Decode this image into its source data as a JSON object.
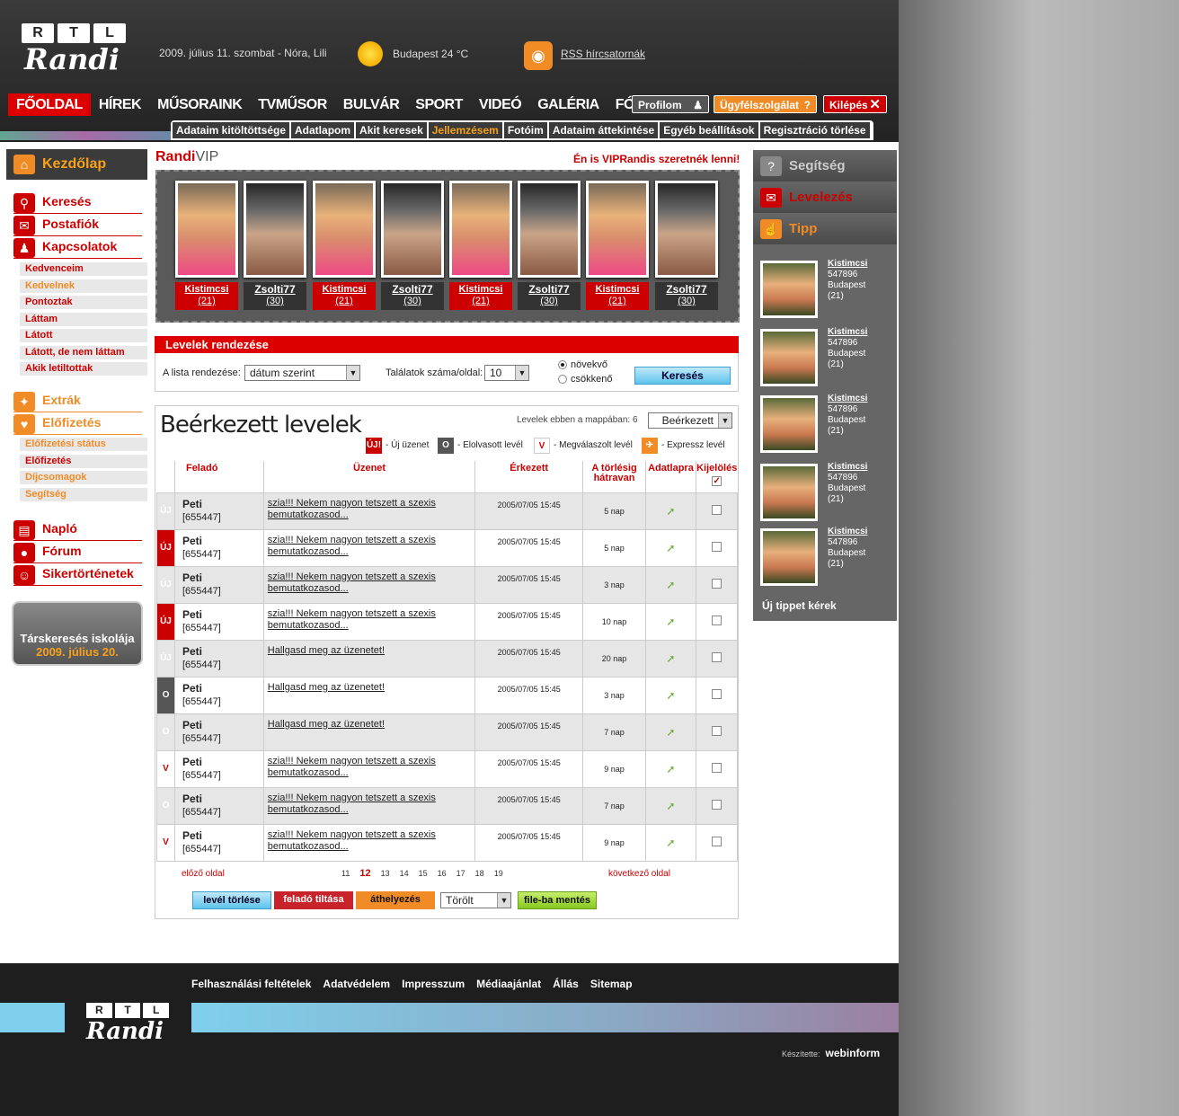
{
  "header": {
    "logo_rtl": [
      "R",
      "T",
      "L"
    ],
    "logo_randi": "Randi",
    "date_line": "2009. július 11. szombat - Nóra, Lili",
    "weather": "Budapest 24 °C",
    "rss": "RSS hírcsatornák"
  },
  "mainnav": [
    "FŐOLDAL",
    "HÍREK",
    "MŰSORAINK",
    "TVMŰSOR",
    "BULVÁR",
    "SPORT",
    "VIDEÓ",
    "GALÉRIA",
    "FÓRUM"
  ],
  "header_buttons": {
    "profile": "Profilom",
    "service": "Ügyfélszolgálat",
    "logout": "Kilépés"
  },
  "subnav": [
    "Adataim kitöltöttsége",
    "Adatlapom",
    "Akit keresek",
    "Jellemzésem",
    "Fotóim",
    "Adataim áttekintése",
    "Egyéb beállítások",
    "Regisztráció törlése"
  ],
  "sidebar": {
    "home": "Kezdőlap",
    "search": "Keresés",
    "mailbox": "Postafiók",
    "contacts": "Kapcsolatok",
    "contacts_sub": [
      "Kedvenceim",
      "Kedvelnek",
      "Pontoztak",
      "Láttam",
      "Látott",
      "Látott, de nem láttam",
      "Akik letiltottak"
    ],
    "extras": "Extrák",
    "subscription": "Előfizetés",
    "subscription_sub": [
      "Előfizetési státus",
      "Előfizetés",
      "Díjcsomagok",
      "Segítség"
    ],
    "diary": "Napló",
    "forum": "Fórum",
    "stories": "Sikertörténetek",
    "school_title": "Társkeresés iskolája",
    "school_date": "2009. július 20."
  },
  "vip": {
    "label_a": "Randi",
    "label_b": "VIP",
    "link": "Én is VIPRandis szeretnék lenni!",
    "cards": [
      {
        "name": "Kistimcsi",
        "age": "(21)"
      },
      {
        "name": "Zsolti77",
        "age": "(30)"
      },
      {
        "name": "Kistimcsi",
        "age": "(21)"
      },
      {
        "name": "Zsolti77",
        "age": "(30)"
      },
      {
        "name": "Kistimcsi",
        "age": "(21)"
      },
      {
        "name": "Zsolti77",
        "age": "(30)"
      },
      {
        "name": "Kistimcsi",
        "age": "(21)"
      },
      {
        "name": "Zsolti77",
        "age": "(30)"
      }
    ]
  },
  "sort": {
    "title": "Levelek rendezése",
    "order_label": "A lista rendezése:",
    "order_value": "dátum szerint",
    "count_label": "Találatok száma/oldal:",
    "count_value": "10",
    "asc": "növekvő",
    "desc": "csökkenő",
    "search": "Keresés"
  },
  "inbox": {
    "title": "Beérkezett levelek",
    "folder_label": "Levelek ebben a mappában: 6",
    "folder_value": "Beérkezett",
    "legend": [
      {
        "mark": "ÚJ!",
        "text": "- Új üzenet"
      },
      {
        "mark": "O",
        "text": "- Elolvasott levél"
      },
      {
        "mark": "V",
        "text": "- Megválaszolt levél"
      },
      {
        "mark": "✈",
        "text": "- Expressz levél"
      }
    ],
    "columns": [
      "Feladó",
      "Üzenet",
      "Érkezett",
      "A törlésig hátravan",
      "Adatlapra",
      "Kijelölés"
    ],
    "rows": [
      {
        "status": "ÚJ",
        "sender": "Peti",
        "id": "[655447]",
        "msg": "szia!!! Nekem nagyon tetszett a szexis bemutatkozasod...",
        "date": "2005/07/05 15:45",
        "left": "5 nap"
      },
      {
        "status": "ÚJ",
        "sender": "Peti",
        "id": "[655447]",
        "msg": "szia!!! Nekem nagyon tetszett a szexis bemutatkozasod...",
        "date": "2005/07/05 15:45",
        "left": "5 nap"
      },
      {
        "status": "ÚJ",
        "sender": "Peti",
        "id": "[655447]",
        "msg": "szia!!! Nekem nagyon tetszett a szexis bemutatkozasod...",
        "date": "2005/07/05 15:45",
        "left": "3 nap"
      },
      {
        "status": "ÚJ",
        "sender": "Peti",
        "id": "[655447]",
        "msg": "szia!!! Nekem nagyon tetszett a szexis bemutatkozasod...",
        "date": "2005/07/05 15:45",
        "left": "10 nap"
      },
      {
        "status": "ÚJ",
        "sender": "Peti",
        "id": "[655447]",
        "msg": "Hallgasd meg az üzenetet!",
        "date": "2005/07/05 15:45",
        "left": "20 nap"
      },
      {
        "status": "O",
        "sender": "Peti",
        "id": "[655447]",
        "msg": "Hallgasd meg az üzenetet!",
        "date": "2005/07/05 15:45",
        "left": "3 nap"
      },
      {
        "status": "O",
        "sender": "Peti",
        "id": "[655447]",
        "msg": "Hallgasd meg az üzenetet!",
        "date": "2005/07/05 15:45",
        "left": "7 nap"
      },
      {
        "status": "V",
        "sender": "Peti",
        "id": "[655447]",
        "msg": "szia!!! Nekem nagyon tetszett a szexis bemutatkozasod...",
        "date": "2005/07/05 15:45",
        "left": "9 nap"
      },
      {
        "status": "O",
        "sender": "Peti",
        "id": "[655447]",
        "msg": "szia!!! Nekem nagyon tetszett a szexis bemutatkozasod...",
        "date": "2005/07/05 15:45",
        "left": "7 nap"
      },
      {
        "status": "V",
        "sender": "Peti",
        "id": "[655447]",
        "msg": "szia!!! Nekem nagyon tetszett a szexis bemutatkozasod...",
        "date": "2005/07/05 15:45",
        "left": "9 nap"
      }
    ],
    "prev": "előző oldal",
    "next": "következő oldal",
    "pages": [
      "11",
      "12",
      "13",
      "14",
      "15",
      "16",
      "17",
      "18",
      "19"
    ],
    "current_page": "12",
    "actions": {
      "delete": "levél törlése",
      "block": "feladó tiltása",
      "move": "áthelyezés",
      "folder": "Törölt",
      "save": "file-ba mentés"
    }
  },
  "right": {
    "help": "Segítség",
    "mail": "Levelezés",
    "tip": "Tipp",
    "tips": [
      {
        "name": "Kistimcsi",
        "id": "547896",
        "city": "Budapest",
        "age": "(21)"
      },
      {
        "name": "Kistimcsi",
        "id": "547896",
        "city": "Budapest",
        "age": "(21)"
      },
      {
        "name": "Kistimcsi",
        "id": "547896",
        "city": "Budapest",
        "age": "(21)"
      },
      {
        "name": "Kistimcsi",
        "id": "547896",
        "city": "Budapest",
        "age": "(21)"
      },
      {
        "name": "Kistimcsi",
        "id": "547896",
        "city": "Budapest",
        "age": "(21)"
      }
    ],
    "new_tip": "Új tippet kérek"
  },
  "footer": {
    "links": [
      "Felhasználási feltételek",
      "Adatvédelem",
      "Impresszum",
      "Médiaajánlat",
      "Állás",
      "Sitemap"
    ],
    "credit_label": "Készítette:",
    "credit_name": "webinform"
  },
  "colors": {
    "brand_red": "#d00000",
    "accent_orange": "#f08b26",
    "button_blue": "#5fc3ea"
  }
}
